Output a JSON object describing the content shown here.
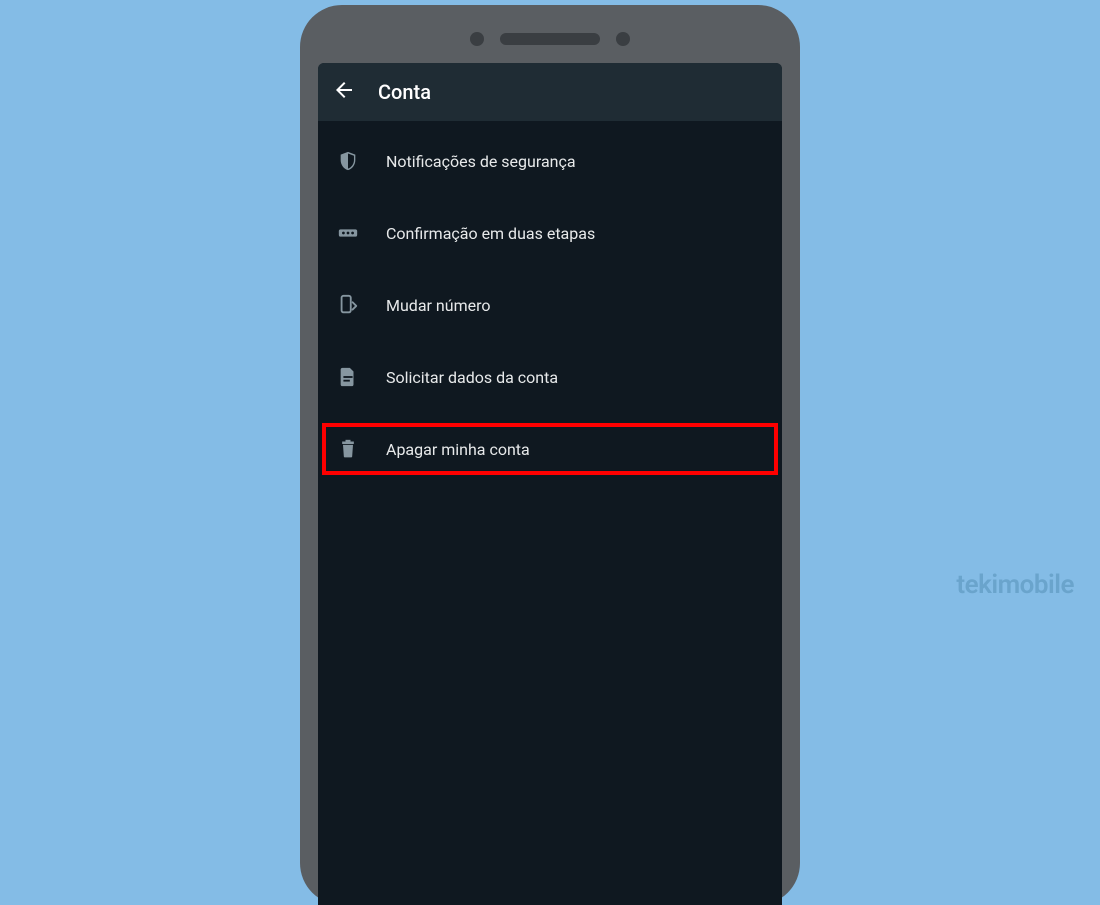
{
  "header": {
    "title": "Conta"
  },
  "menu": {
    "items": [
      {
        "icon": "shield",
        "label": "Notificações de segurança",
        "highlighted": false
      },
      {
        "icon": "password",
        "label": "Confirmação em duas etapas",
        "highlighted": false
      },
      {
        "icon": "changenum",
        "label": "Mudar número",
        "highlighted": false
      },
      {
        "icon": "document",
        "label": "Solicitar dados da conta",
        "highlighted": false
      },
      {
        "icon": "trash",
        "label": "Apagar minha conta",
        "highlighted": true
      }
    ]
  },
  "watermark": "tekimobile",
  "colors": {
    "background": "#84bce6",
    "phoneFrame": "#5a5e62",
    "screen": "#0f1820",
    "appBar": "#1f2c34",
    "iconMuted": "#8696a0",
    "text": "#e7e9ea",
    "highlight": "#ff0000"
  }
}
